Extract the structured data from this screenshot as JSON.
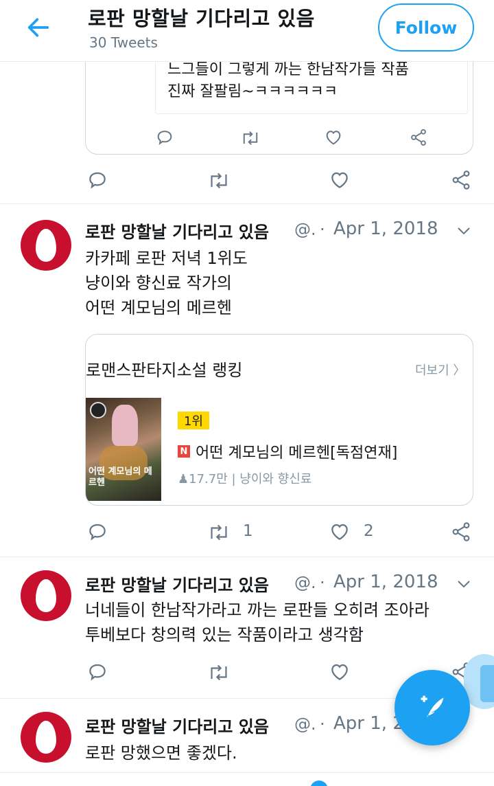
{
  "header": {
    "title": "로판 망할날 기다리고 있음",
    "tweet_count": "30 Tweets",
    "follow_label": "Follow"
  },
  "quoted": {
    "text": "느그들이 그렇게 까는 한남작가들 작품\n진짜 잘팔림~ㅋㅋㅋㅋㅋㅋ"
  },
  "tweets": [
    {
      "name": "로판 망할날 기다리고 있음",
      "handle": "@.",
      "sep": "·",
      "date": "Apr 1, 2018",
      "text": "카카페 로판 저녁 1위도\n냥이와 향신료 작가의\n어떤 계모님의 메르헨",
      "retweets": "1",
      "likes": "2"
    },
    {
      "name": "로판 망할날 기다리고 있음",
      "handle": "@.",
      "sep": "·",
      "date": "Apr 1, 2018",
      "text": "너네들이 한남작가라고 까는 로판들 오히려 조아라\n투베보다 창의력 있는 작품이라고 생각함"
    },
    {
      "name": "로판 망할날 기다리고 있음",
      "handle": "@.",
      "sep": "·",
      "date": "Apr 1, 2",
      "text": "로판 망했으면 좋겠다."
    }
  ],
  "ranking_card": {
    "title": "로맨스판타지소설 랭킹",
    "more": "더보기 〉",
    "cover_title": "어떤 계모님의 메르헨",
    "rank": "1위",
    "badge": "N",
    "book": "어떤 계모님의 메르헨[독점연재]",
    "meta": "♟17.7만 | 냥이와 향신료"
  },
  "colors": {
    "accent": "#1da1f2",
    "avatar": "#c8102e",
    "secondary_text": "#657786",
    "border": "#ccd6dd"
  },
  "icons": [
    "back-arrow-icon",
    "reply-icon",
    "retweet-icon",
    "like-icon",
    "share-icon",
    "chevron-down-icon",
    "compose-tweet-icon"
  ]
}
